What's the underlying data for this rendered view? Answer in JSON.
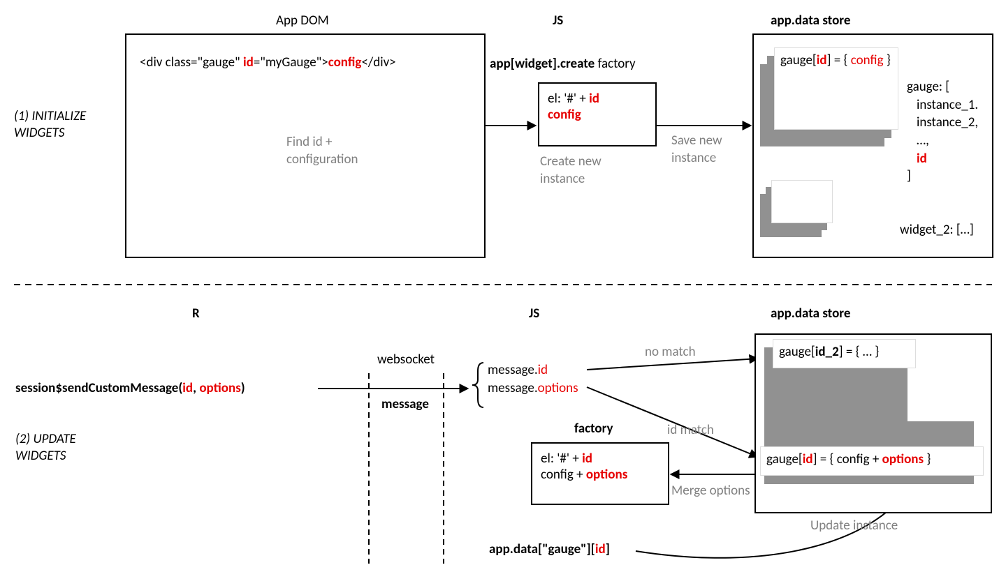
{
  "colors": {
    "accent_red": "#e60000",
    "grey": "#808080"
  },
  "top": {
    "headers": {
      "dom": "App DOM",
      "js": "JS",
      "store": "app.data store"
    },
    "section_label": "(1) INITIALIZE WIDGETS",
    "dom_code": {
      "p1": "<div class=\"gauge\" ",
      "p2": "id",
      "p3": "=\"myGauge\">",
      "p4": "config",
      "p5": "</div>"
    },
    "find_label": "Find id + configuration",
    "factory_title_pre": "app[widget].create",
    "factory_title_post": " factory",
    "factory_box": {
      "line1_pre": "el: '#' + ",
      "line1_red": "id",
      "line2": "config"
    },
    "create_label": "Create new instance",
    "save_label": "Save new instance",
    "store": {
      "gauge_card_pre": "gauge[",
      "gauge_card_id": "id",
      "gauge_card_mid": "] = { ",
      "gauge_card_cfg": "config",
      "gauge_card_end": " }",
      "list_head": "gauge: [",
      "list_i1": "instance_1.",
      "list_i2": "instance_2,",
      "list_dots": "…,",
      "list_id": "id",
      "list_close": "]",
      "widget2": "widget_2: […]"
    }
  },
  "bottom": {
    "headers": {
      "r": "R",
      "js": "JS",
      "store": "app.data store"
    },
    "section_label": "(2) UPDATE WIDGETS",
    "r_call": {
      "pre": "session$sendCustomMessage(",
      "id": "id",
      "mid": ", ",
      "opts": "options",
      "end": ")"
    },
    "websocket": "websocket",
    "message": "message",
    "msg": {
      "l1_pre": "message.",
      "l1_red": "id",
      "l2_pre": "message.",
      "l2_red": "options"
    },
    "no_match": "no match",
    "id_match": "id match",
    "factory_title": "factory",
    "factory_box": {
      "l1_pre": "el: '#' + ",
      "l1_red": "id",
      "l2_pre": "config + ",
      "l2_red": "options"
    },
    "merge": "Merge options",
    "update": "Update instance",
    "store": {
      "card1_pre": "gauge[",
      "card1_mid": "id_2",
      "card1_end": "] = { … }",
      "card2_pre": "gauge[",
      "card2_id": "id",
      "card2_mid": "] = { config + ",
      "card2_opts": "options",
      "card2_end": " }"
    },
    "lookup": {
      "pre": "app.data[\"gauge\"][",
      "id": "id",
      "end": "]"
    }
  }
}
